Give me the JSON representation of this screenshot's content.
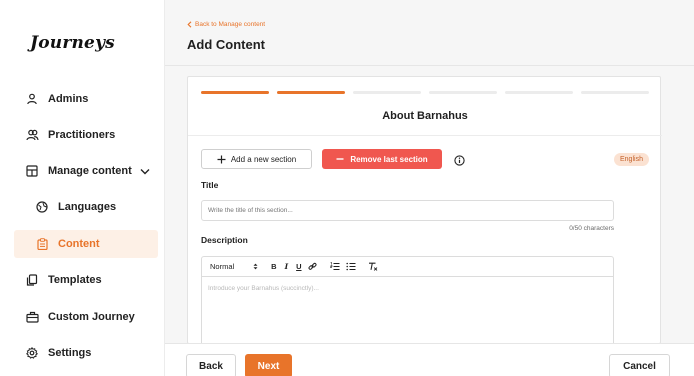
{
  "sidebar": {
    "logo": "Journeys",
    "items": [
      {
        "label": "Admins",
        "icon": "user-icon"
      },
      {
        "label": "Practitioners",
        "icon": "users-icon"
      },
      {
        "label": "Manage content",
        "icon": "layout-icon",
        "expanded": true
      },
      {
        "label": "Languages",
        "icon": "globe-icon"
      },
      {
        "label": "Content",
        "icon": "clipboard-icon",
        "active": true
      },
      {
        "label": "Templates",
        "icon": "copy-icon"
      },
      {
        "label": "Custom Journey",
        "icon": "briefcase-icon"
      },
      {
        "label": "Settings",
        "icon": "gear-icon"
      }
    ]
  },
  "header": {
    "back_link": "Back to Manage content",
    "title": "Add Content"
  },
  "wizard": {
    "steps_total": 6,
    "steps_completed": 2,
    "section_title": "About Barnahus"
  },
  "actions": {
    "add_section": "Add a new section",
    "remove_section": "Remove last section",
    "language_badge": "English"
  },
  "form": {
    "title_label": "Title",
    "title_placeholder": "Write the title of this section...",
    "title_value": "",
    "counter": "0/50 characters",
    "description_label": "Description",
    "format_select": "Normal",
    "description_placeholder": "Introduce your Barnahus (succinctly)..."
  },
  "footer": {
    "back": "Back",
    "next": "Next",
    "cancel": "Cancel"
  },
  "colors": {
    "accent": "#e8742a",
    "danger": "#f0574f",
    "badge_bg": "#fbe2d2"
  }
}
